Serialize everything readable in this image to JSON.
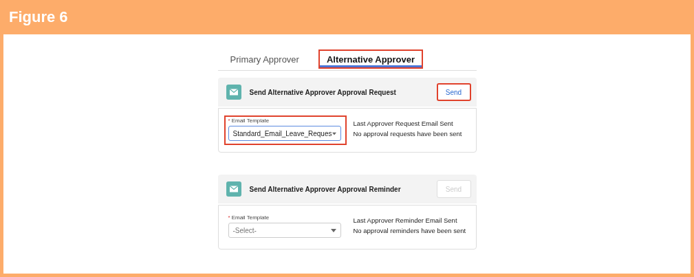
{
  "figure_title": "Figure 6",
  "tabs": [
    {
      "label": "Primary Approver",
      "selected": false,
      "highlighted": false
    },
    {
      "label": "Alternative Approver",
      "selected": true,
      "highlighted": true
    }
  ],
  "cards": [
    {
      "title": "Send Alternative Approver Approval Request",
      "send_button": {
        "label": "Send",
        "disabled": false,
        "highlighted": true
      },
      "field": {
        "required_mark": "*",
        "label": "Email Template",
        "value": "Standard_Email_Leave_Reques",
        "highlighted": true
      },
      "status_title": "Last Approver Request Email Sent",
      "status_text": "No approval requests have been sent"
    },
    {
      "title": "Send Alternative Approver Approval Reminder",
      "send_button": {
        "label": "Send",
        "disabled": true,
        "highlighted": false
      },
      "field": {
        "required_mark": "*",
        "label": "Email Template",
        "placeholder": "-Select-",
        "highlighted": false
      },
      "status_title": "Last Approver Reminder Email Sent",
      "status_text": "No approval reminders have been sent"
    }
  ]
}
